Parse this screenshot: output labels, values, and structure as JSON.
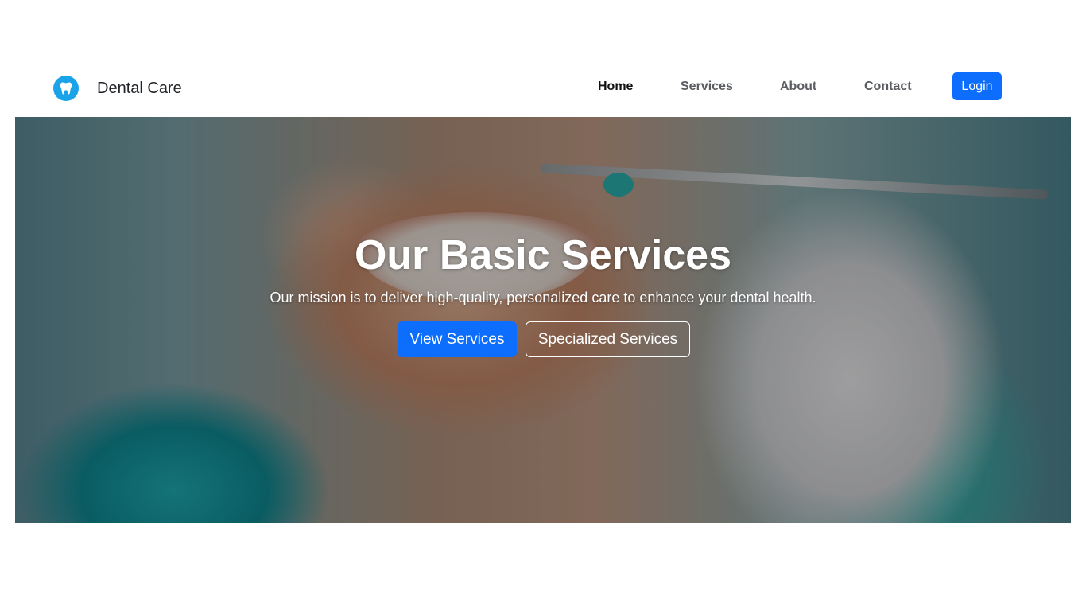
{
  "brand": {
    "name": "Dental Care",
    "logo_icon": "tooth-icon",
    "logo_color": "#1aa3e8"
  },
  "nav": {
    "items": [
      {
        "label": "Home",
        "active": true
      },
      {
        "label": "Services",
        "active": false
      },
      {
        "label": "About",
        "active": false
      },
      {
        "label": "Contact",
        "active": false
      }
    ],
    "login_label": "Login"
  },
  "hero": {
    "title": "Our Basic Services",
    "subtitle": "Our mission is to deliver high-quality, personalized care to enhance your dental health.",
    "primary_button": "View Services",
    "secondary_button": "Specialized Services"
  },
  "colors": {
    "accent": "#0d6efd",
    "nav_active": "#111111",
    "nav_inactive": "#5a5d61"
  }
}
